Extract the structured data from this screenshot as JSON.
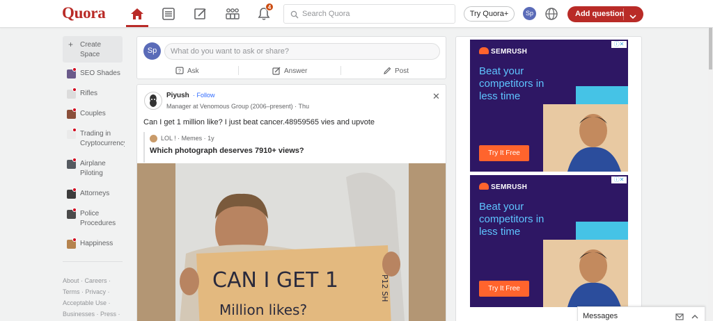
{
  "header": {
    "logo": "Quora",
    "notification_count": "4",
    "search_placeholder": "Search Quora",
    "try_label": "Try Quora+",
    "avatar_initials": "Sp",
    "add_question_label": "Add question",
    "accent_color": "#b92b27"
  },
  "sidebar": {
    "create_space_label": "Create Space",
    "items": [
      {
        "label": "SEO Shades",
        "icon": "space-seo-icon"
      },
      {
        "label": "Rifles",
        "icon": "space-rifles-icon"
      },
      {
        "label": "Couples",
        "icon": "space-couples-icon"
      },
      {
        "label": "Trading in Cryptocurrency",
        "icon": "space-trading-icon"
      },
      {
        "label": "Airplane Piloting",
        "icon": "space-airplane-icon"
      },
      {
        "label": "Attorneys",
        "icon": "space-attorneys-icon"
      },
      {
        "label": "Police Procedures",
        "icon": "space-police-icon"
      },
      {
        "label": "Happiness",
        "icon": "space-happiness-icon"
      }
    ],
    "footer_links": [
      "About",
      "Careers",
      "Terms",
      "Privacy",
      "Acceptable Use",
      "Businesses",
      "Press"
    ]
  },
  "ask_card": {
    "avatar_initials": "Sp",
    "placeholder": "What do you want to ask or share?",
    "ask_label": "Ask",
    "answer_label": "Answer",
    "post_label": "Post"
  },
  "post": {
    "author": "Piyush",
    "follow_label": "Follow",
    "credential": "Manager at Venomous Group (2006–present) · Thu",
    "text": "Can I get 1 million like? I just beat cancer.48959565 vies and upvote",
    "quoted_meta": "LOL ! · Memes · 1y",
    "quoted_title": "Which photograph deserves 7910+ views?",
    "image_sign_line1": "CAN I GET 1",
    "image_sign_line2": "Million likes?",
    "image_sign_side": "P12 SH"
  },
  "ads": [
    {
      "brand": "SEMRUSH",
      "headline": "Beat your competitors in less time",
      "cta": "Try It Free"
    },
    {
      "brand": "SEMRUSH",
      "headline": "Beat your competitors in less time",
      "cta": "Try It Free"
    }
  ],
  "messages": {
    "label": "Messages"
  }
}
